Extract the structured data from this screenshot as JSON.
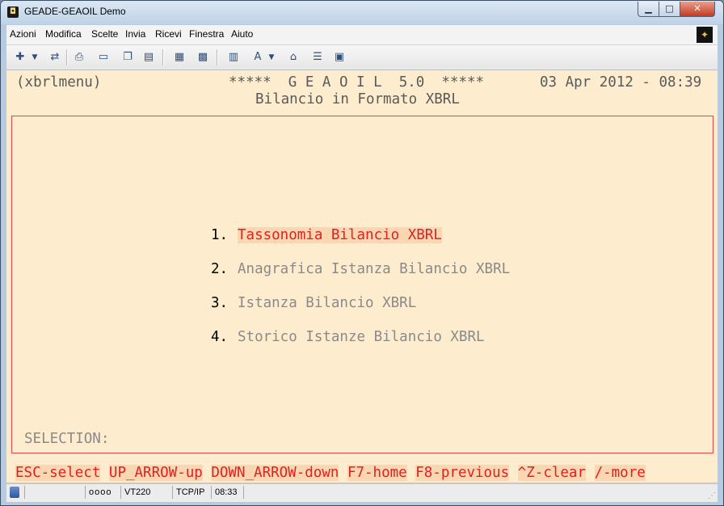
{
  "window": {
    "title": "GEADE-GEAOIL Demo"
  },
  "menu": [
    "Azioni",
    "Modifica",
    "Scelte",
    "Invia",
    "Ricevi",
    "Finestra",
    "Aiuto"
  ],
  "terminal": {
    "program": "(xbrlmenu)",
    "app_banner": "*****  G E A O I L  5.0  *****",
    "datetime": "03 Apr 2012 - 08:39",
    "screen_title": "Bilancio in Formato XBRL",
    "options": [
      {
        "num": "1.",
        "label": "Tassonomia Bilancio XBRL"
      },
      {
        "num": "2.",
        "label": "Anagrafica Istanza Bilancio XBRL"
      },
      {
        "num": "3.",
        "label": "Istanza Bilancio XBRL"
      },
      {
        "num": "4.",
        "label": "Storico Istanze Bilancio XBRL"
      }
    ],
    "selection_prompt": "SELECTION:",
    "function_keys": [
      "ESC-select",
      "UP_ARROW-up",
      "DOWN_ARROW-down",
      "F7-home",
      "F8-previous",
      "^Z-clear",
      "/-more"
    ]
  },
  "status": {
    "leds": "oooo",
    "terminal_type": "VT220",
    "protocol": "TCP/IP",
    "time": "08:33"
  },
  "colors": {
    "terminal_bg": "#fdeccd",
    "highlight": "#e12020",
    "frame": "#e04545"
  }
}
